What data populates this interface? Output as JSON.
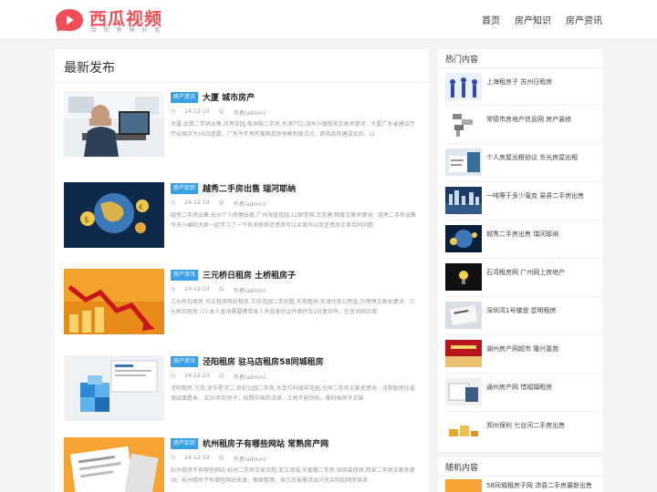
{
  "header": {
    "logo_name": "西瓜视频",
    "logo_slogan": "给 你 新 鲜 好 看",
    "nav": [
      "首页",
      "房产知识",
      "房产资讯"
    ]
  },
  "main": {
    "title": "最新发布",
    "articles": [
      {
        "tag": "房产资讯",
        "title": "大厦 城市房产",
        "date": "24-12-10",
        "author": "作者(admin)",
        "summary": "大厦,武昌二手房出售,月亮花园,株洲购二手房,天津户口,加州小镇租房文章关键词：大厦广东省建设厅厅长周庆为16日透露，广东今年将开展商品房预售制度试点，即商品房建成买后。以"
      },
      {
        "tag": "房产知识",
        "title": "越秀二手房出售 瑞河耶纳",
        "date": "24-12-10",
        "author": "作者(admin)",
        "summary": "越秀二手房出售,长沙个人房屋出租,广州海蓝花园,12即堂网,王京唐,物度文章关键词：越秀二手房出售今天小编和大家一起学习了一下有关核销还债房可以买卖吗以及还债房买卖合同问题"
      },
      {
        "tag": "房产资讯",
        "title": "三元桥日租房 土桥租房子",
        "date": "24-12-10",
        "author": "作者(admin)",
        "summary": "三元桥日租房,乌兰租房网近租房,王府花园二手别墅,东莞租房,天津住房公积金,万师博文章关键词：三元桥日租房 (1) 本人查询需要携带本人有效身份证件原件及1份复印件。在查询网点填"
      },
      {
        "tag": "房产资讯",
        "title": "泾阳租房 驻马店租房58同城租房",
        "date": "24-12-10",
        "author": "作者(admin)",
        "summary": "泾阳租房,方郊,龙华星河二,世纪公园二手房,大连万科城市花园,光伸二手房文章关键词：泾阳租房在道德层面看来，买30年的房子，按照中国的法律，土地不能你的，哪时候房子买破"
      },
      {
        "tag": "房产知识",
        "title": "杭州租房子有哪些网站 常熟房产网",
        "date": "24-12-10",
        "author": "作者(admin)",
        "summary": "杭州租房子有哪些网站,杭州二手房交易流程,浙江湾城,华番路二手房,深圳装修网,西安二手房文章关键词：杭州租房子有哪些网站来源：搞家整理，卖方反报需求出问无买购知网房供求"
      }
    ]
  },
  "sidebar": {
    "hot_title": "热门内容",
    "hot_items": [
      "上海租房子 苏州日租房",
      "常德市房地产信息网 房产装修",
      "个人房屋出租协议 东光房屋出租",
      "一吨等于多少毫克 易县二手房出售",
      "越秀二手房出售 瑞河耶纳",
      "石湾租房网 广州网上房地产",
      "深圳湾1号楼盘 昆明租房",
      "湖州房产网超市 隆兴嘉苑",
      "通州房产网 惜福镇租房",
      "郑州保利 七台河二手房出售"
    ],
    "random_title": "随机内容",
    "random_items": [
      "58同城租房子网 沛县二手房最新出售"
    ]
  },
  "colors": {
    "brand": "#f04e59",
    "tag": "#3aa0e6"
  }
}
